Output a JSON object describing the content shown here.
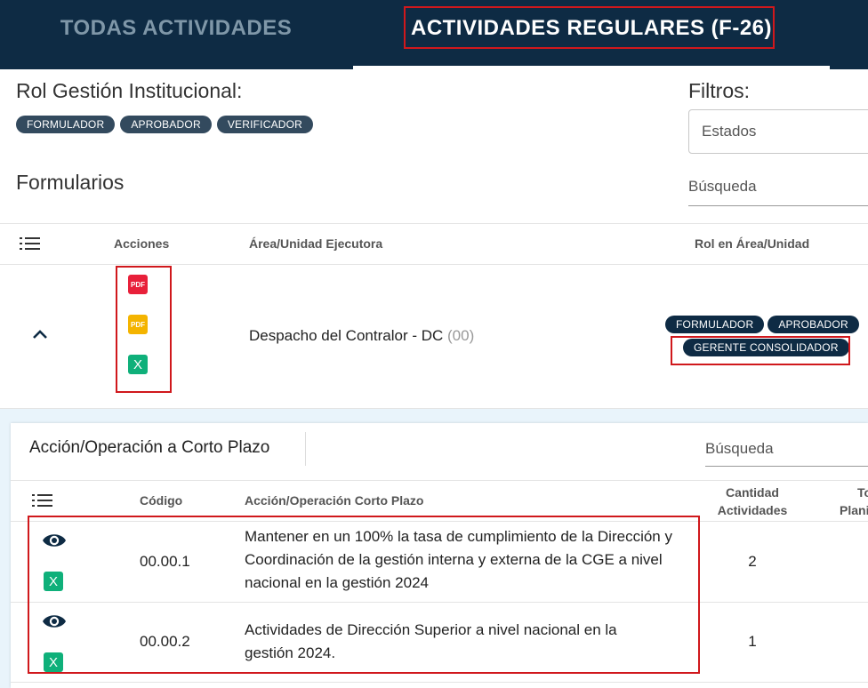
{
  "tabs": {
    "all": "TODAS ACTIVIDADES",
    "regular": "ACTIVIDADES REGULARES (F-26)"
  },
  "header": {
    "role_title": "Rol Gestión Institucional:",
    "roles": [
      "FORMULADOR",
      "APROBADOR",
      "VERIFICADOR"
    ],
    "filters_title": "Filtros:",
    "states_placeholder": "Estados",
    "search_placeholder": "Búsqueda",
    "forms_title": "Formularios"
  },
  "table": {
    "headers": {
      "actions": "Acciones",
      "area": "Área/Unidad Ejecutora",
      "role": "Rol en Área/Unidad"
    },
    "row": {
      "pdf1": "PDF",
      "pdf2": "PDF",
      "excel": "X",
      "area_name": "Despacho del Contralor - DC",
      "area_code": "(00)",
      "roles": [
        "FORMULADOR",
        "APROBADOR"
      ],
      "consolidator_role": "GERENTE CONSOLIDADOR"
    }
  },
  "subtable": {
    "title": "Acción/Operación a Corto Plazo",
    "search_placeholder": "Búsqueda",
    "headers": {
      "code": "Código",
      "action": "Acción/Operación Corto Plazo",
      "count_line1": "Cantidad",
      "count_line2": "Actividades",
      "total_line1": "To",
      "total_line2": "Plani"
    },
    "rows": [
      {
        "excel": "X",
        "code": "00.00.1",
        "action": "Mantener en un 100% la tasa de cumplimiento de la Dirección y Coordinación de la gestión interna y externa de la CGE a nivel nacional en la gestión 2024",
        "count": "2"
      },
      {
        "excel": "X",
        "code": "00.00.2",
        "action": "Actividades de Dirección Superior a nivel nacional en la gestión 2024.",
        "count": "1"
      }
    ]
  },
  "colors": {
    "navy": "#0e2b44",
    "chip": "#334a5e",
    "highlight": "#d0181c",
    "pdf_red": "#e8203a",
    "pdf_yellow": "#f4b400",
    "excel_green": "#0fb07a"
  }
}
